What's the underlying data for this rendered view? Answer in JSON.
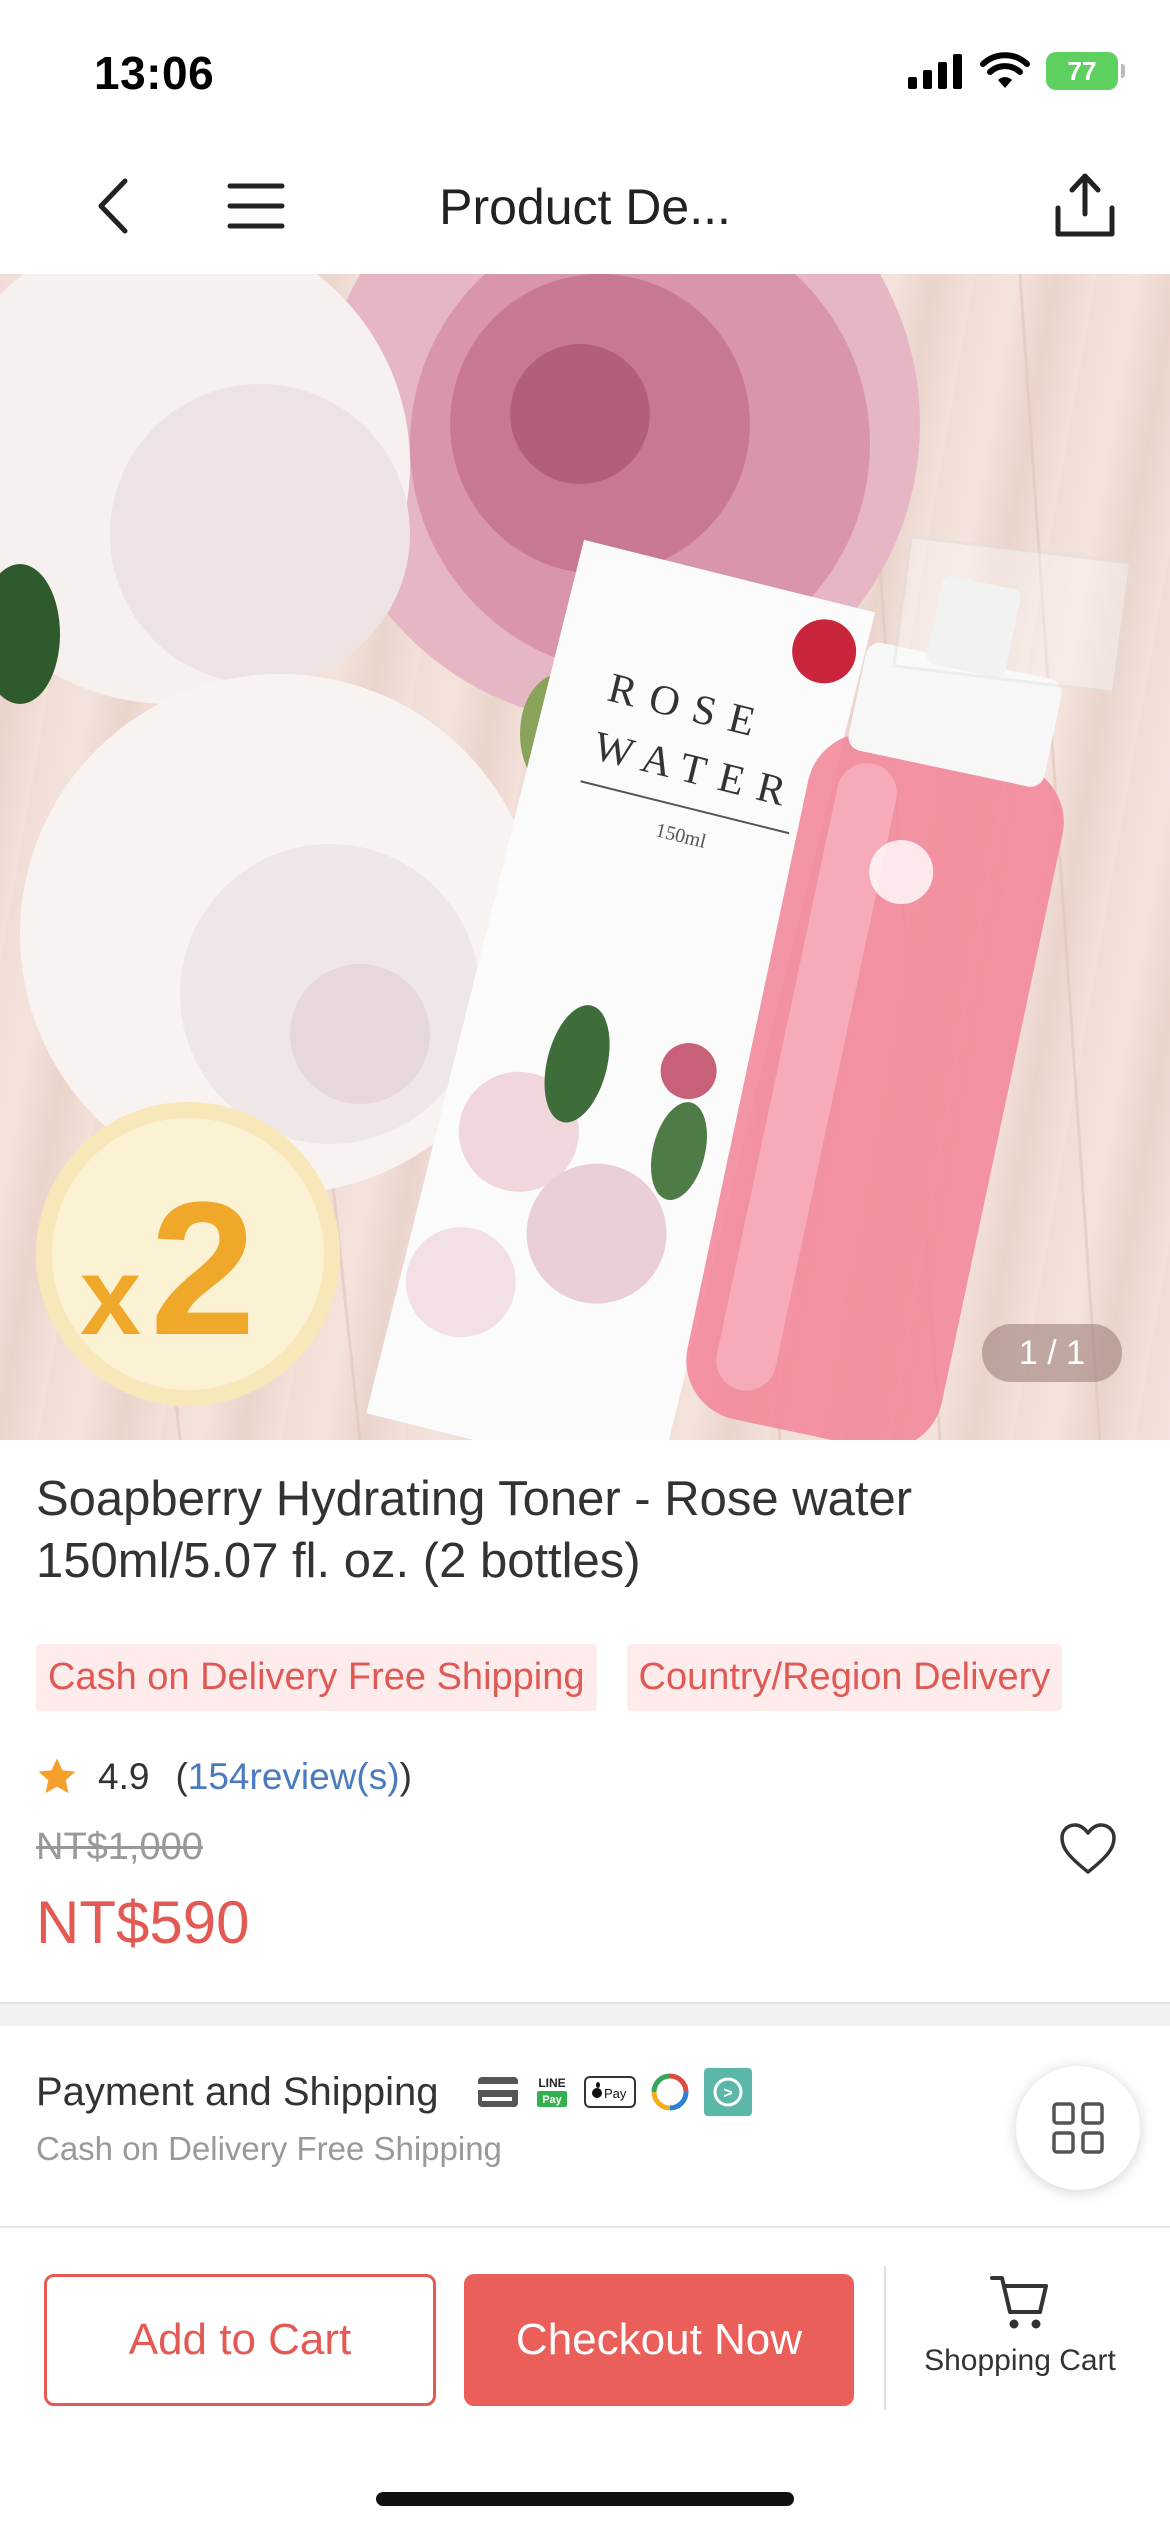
{
  "status_bar": {
    "time": "13:06",
    "battery": "77",
    "icons": [
      "signal-icon",
      "wifi-icon",
      "battery-icon"
    ]
  },
  "nav": {
    "title": "Product De...",
    "icons": [
      "back-icon",
      "menu-icon",
      "share-icon"
    ]
  },
  "hero": {
    "counter": "1 / 1",
    "badge": "x2",
    "box_text": "ROSE WATER",
    "box_volume": "150ml"
  },
  "product": {
    "title": "Soapberry Hydrating Toner - Rose water 150ml/5.07 fl. oz. (2 bottles)",
    "tags": [
      "Cash on Delivery Free Shipping",
      "Country/Region Delivery"
    ],
    "rating": "4.9",
    "reviews_open": "(",
    "reviews_link": "154review(s)",
    "reviews_close": ")",
    "old_price": "NT$1,000",
    "price": "NT$590"
  },
  "payment": {
    "title": "Payment and Shipping",
    "subtitle": "Cash on Delivery Free Shipping",
    "icons": [
      "credit-card-icon",
      "line-pay-icon",
      "apple-pay-icon",
      "jko-pay-icon",
      "atome-pay-icon"
    ],
    "line_pay_top": "LINE",
    "line_pay_bottom": "Pay",
    "apple_pay": "Pay"
  },
  "bottom_bar": {
    "add_to_cart": "Add to Cart",
    "checkout": "Checkout Now",
    "cart_label": "Shopping Cart"
  },
  "colors": {
    "accent": "#e35a55",
    "tag_bg": "#fdeceb",
    "link": "#4a7ac0",
    "star": "#f4a02a"
  }
}
